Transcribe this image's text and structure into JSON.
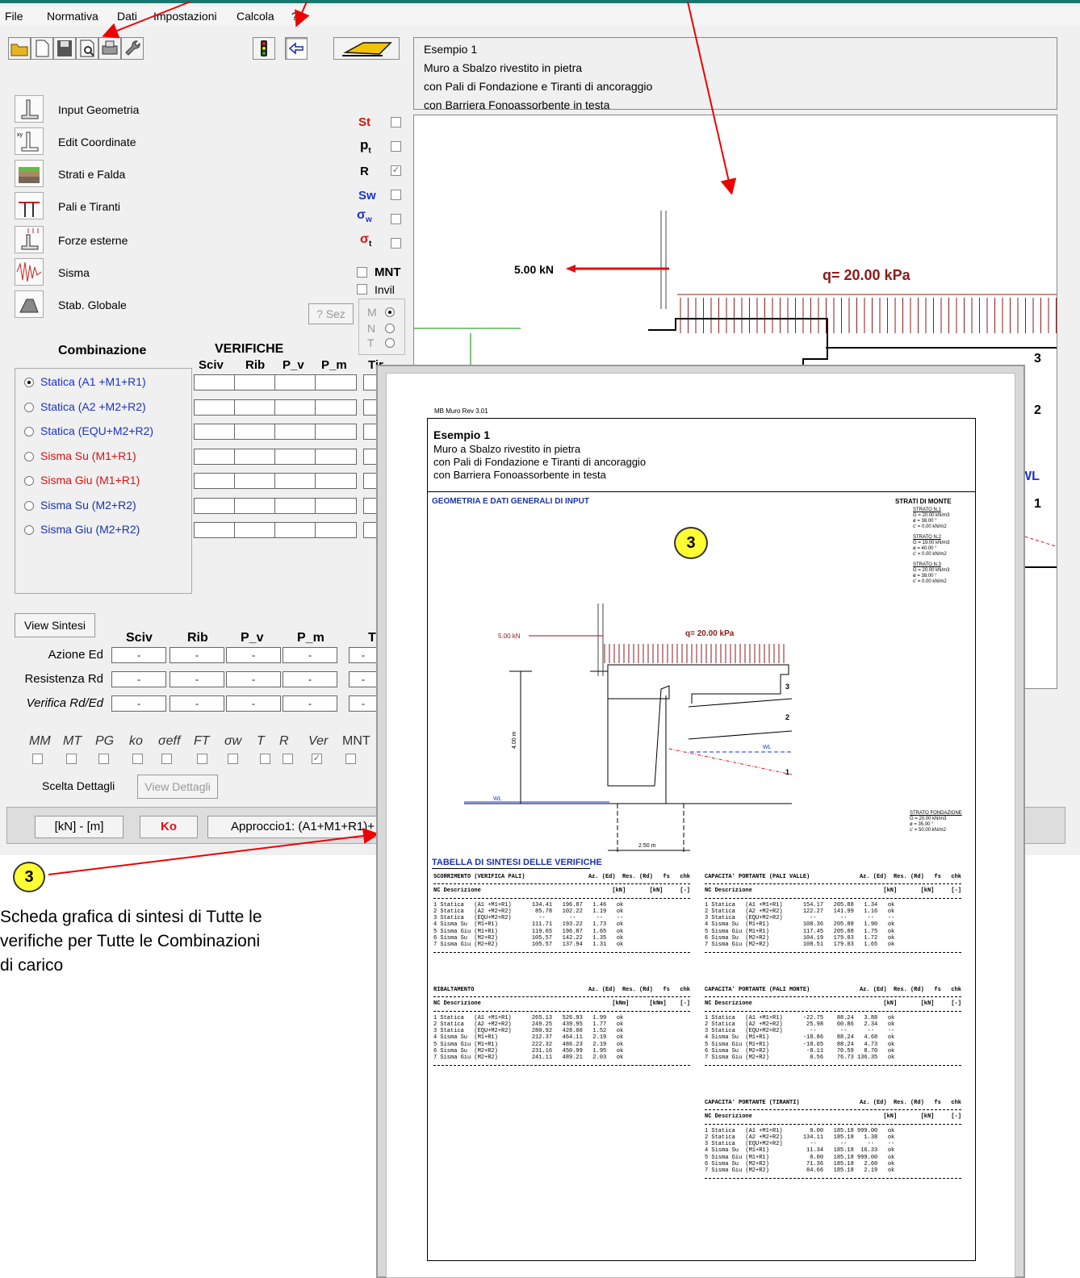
{
  "menu": [
    "File",
    "Normativa",
    "Dati",
    "Impostazioni",
    "Calcola",
    "?"
  ],
  "project": {
    "title": "Esempio 1",
    "line1": "Muro a Sbalzo rivestito in pietra",
    "line2": "con Pali di Fondazione e Tiranti di ancoraggio",
    "line3": "con Barriera Fonoassorbente in testa"
  },
  "sidebar": [
    {
      "label": "Input Geometria",
      "icon": "wall-geometry-icon"
    },
    {
      "label": "Edit Coordinate",
      "icon": "coordinates-icon"
    },
    {
      "label": "Strati e Falda",
      "icon": "layers-icon"
    },
    {
      "label": "Pali e Tiranti",
      "icon": "piles-icon"
    },
    {
      "label": "Forze esterne",
      "icon": "forces-icon"
    },
    {
      "label": "Sisma",
      "icon": "seismic-icon"
    },
    {
      "label": "Stab. Globale",
      "icon": "global-stability-icon"
    }
  ],
  "toggles": {
    "st": "St",
    "pt": "p",
    "pt_sub": "t",
    "r": "R",
    "sw": "Sw",
    "sw2": "σ",
    "sw2_sub": "w",
    "st2": "σ",
    "st2_sub": "t",
    "mnt": "MNT",
    "invil": "Invil",
    "sez": "? Sez",
    "m": "M",
    "n": "N",
    "t": "T"
  },
  "combinazioni": {
    "header": "Combinazione",
    "verifiche": "VERIFICHE",
    "cols": [
      "Sciv",
      "Rib",
      "P_v",
      "P_m",
      "Tir"
    ],
    "items": [
      {
        "label": "Statica  (A1 +M1+R1)",
        "color": "#1a33cc",
        "selected": true
      },
      {
        "label": "Statica  (A2 +M2+R2)",
        "color": "#1a33cc",
        "selected": false
      },
      {
        "label": "Statica  (EQU+M2+R2)",
        "color": "#1a33cc",
        "selected": false
      },
      {
        "label": "Sisma Su  (M1+R1)",
        "color": "#dd1111",
        "selected": false
      },
      {
        "label": "Sisma Giu (M1+R1)",
        "color": "#dd1111",
        "selected": false
      },
      {
        "label": "Sisma Su  (M2+R2)",
        "color": "#1a33aa",
        "selected": false
      },
      {
        "label": "Sisma Giu (M2+R2)",
        "color": "#1a33aa",
        "selected": false
      }
    ]
  },
  "sintesi": {
    "button": "View Sintesi",
    "cols": [
      "Sciv",
      "Rib",
      "P_v",
      "P_m",
      "T"
    ],
    "rows": [
      {
        "label": "Azione Ed",
        "values": [
          "-",
          "-",
          "-",
          "-",
          "-"
        ]
      },
      {
        "label": "Resistenza Rd",
        "values": [
          "-",
          "-",
          "-",
          "-",
          "-"
        ]
      },
      {
        "label": "Verifica Rd/Ed",
        "values": [
          "-",
          "-",
          "-",
          "-",
          "-"
        ]
      }
    ]
  },
  "flags": [
    "MM",
    "MT",
    "PG",
    "ko",
    "σeff",
    "FT",
    "σw",
    "T",
    "R",
    "Ver",
    "MNT"
  ],
  "dettagli": {
    "label": "Scelta Dettagli",
    "button": "View Dettagli"
  },
  "status": {
    "units": "[kN] - [m]",
    "result": "Ko",
    "approach": "Approccio1: (A1+M1+R1)+"
  },
  "drawing": {
    "force": "5.00 kN",
    "load": "q= 20.00 kPa",
    "layers": [
      "3",
      "2",
      "1"
    ],
    "wl": "WL"
  },
  "annotation": {
    "badge": "3",
    "text": "Scheda grafica di sintesi di Tutte le verifiche per Tutte le Combinazioni di carico"
  },
  "report": {
    "rev": "MB Muro Rev 3.01",
    "section_geo": "GEOMETRIA E DATI GENERALI DI INPUT",
    "strati_title": "STRATI DI MONTE",
    "strati": [
      {
        "name": "STRATO N.1",
        "g": "G = 20.00 kN/m3",
        "phi": "ø  = 38.00 °",
        "c": "c' = 0.00 kN/m2"
      },
      {
        "name": "STRATO N.2",
        "g": "G = 19.00 kN/m3",
        "phi": "ø  = 40.00 °",
        "c": "c' = 0.00 kN/m2"
      },
      {
        "name": "STRATO N.3",
        "g": "G = 20.00 kN/m3",
        "phi": "ø  = 38.00 °",
        "c": "c' = 0.00 kN/m2"
      }
    ],
    "fondazione": {
      "name": "STRATO FONDAZIONE",
      "g": "G = 20.00 kN/m3",
      "phi": "ø  = 35.00 °",
      "c": "c' = 50.00 kN/m2"
    },
    "force": "5.00 kN",
    "load": "q= 20.00 kPa",
    "height": "4.00 m",
    "width": "2.50 m",
    "wl": "WL",
    "layers": [
      "3",
      "2",
      "1"
    ],
    "tab_title": "TABELLA DI SINTESI DELLE VERIFICHE",
    "tables": [
      {
        "title": "SCORRIMENTO (VERIFICA PALI)",
        "units": "[kN]       [kN]     [-]",
        "rows": [
          "1 Statica   (A1 +M1+R1)      134.41   196.87   1.46   ok",
          "2 Statica   (A2 +M2+R2)       85.78   102.22   1.19   ok",
          "3 Statica   (EQU+M2+R2)        --       --      --    --",
          "4 Sisma Su  (M1+R1)          111.71   193.22   1.73   ok",
          "5 Sisma Giu (M1+R1)          119.65   196.87   1.65   ok",
          "6 Sisma Su  (M2+R2)          105.57   142.22   1.35   ok",
          "7 Sisma Giu (M2+R2)          105.57   137.94   1.31   ok"
        ]
      },
      {
        "title": "RIBALTAMENTO",
        "units": "[kNm]      [kNm]    [-]",
        "rows": [
          "1 Statica   (A1 +M1+R1)      265.13   526.93   1.99   ok",
          "2 Statica   (A2 +M2+R2)      249.25   439.95   1.77   ok",
          "3 Statica   (EQU+M2+R2)      280.92   428.00   1.52   ok",
          "4 Sisma Su  (M1+R1)          212.37   464.11   2.19   ok",
          "5 Sisma Giu (M1+R1)          222.32   486.23   2.19   ok",
          "6 Sisma Su  (M2+R2)          231.16   450.99   1.95   ok",
          "7 Sisma Giu (M2+R2)          241.11   489.21   2.03   ok"
        ]
      },
      {
        "title": "CAPACITA' PORTANTE (PALI VALLE)",
        "units": "[kN]       [kN]     [-]",
        "rows": [
          "1 Statica   (A1 +M1+R1)      154.17   205.88   1.34   ok",
          "2 Statica   (A2 +M2+R2)      122.27   141.99   1.16   ok",
          "3 Statica   (EQU+M2+R2)        --       --      --    --",
          "4 Sisma Su  (M1+R1)          108.36   205.88   1.90   ok",
          "5 Sisma Giu (M1+R1)          117.45   205.88   1.75   ok",
          "6 Sisma Su  (M2+R2)          104.19   179.03   1.72   ok",
          "7 Sisma Giu (M2+R2)          108.51   179.03   1.65   ok"
        ]
      },
      {
        "title": "CAPACITA' PORTANTE (PALI MONTE)",
        "units": "[kN]       [kN]     [-]",
        "rows": [
          "1 Statica   (A1 +M1+R1)      -22.75    88.24   3.88   ok",
          "2 Statica   (A2 +M2+R2)       25.98    60.86   2.34   ok",
          "3 Statica   (EQU+M2+R2)        --       --      --    --",
          "4 Sisma Su  (M1+R1)          -18.86    88.24   4.68   ok",
          "5 Sisma Giu (M1+R1)          -18.65    88.24   4.73   ok",
          "6 Sisma Su  (M2+R2)           -8.11    70.59   8.70   ok",
          "7 Sisma Giu (M2+R2)            0.56    76.73 136.35   ok"
        ]
      },
      {
        "title": "CAPACITA' PORTANTE (TIRANTI)",
        "units": "[kN]       [kN]     [-]",
        "rows": [
          "1 Statica   (A1 +M1+R1)        0.00   185.18 999.00   ok",
          "2 Statica   (A2 +M2+R2)      134.11   185.18   1.38   ok",
          "3 Statica   (EQU+M2+R2)        --       --      --    --",
          "4 Sisma Su  (M1+R1)           11.34   185.18  16.33   ok",
          "5 Sisma Giu (M1+R1)            0.00   185.18 999.00   ok",
          "6 Sisma Su  (M2+R2)           71.36   185.18   2.60   ok",
          "7 Sisma Giu (M2+R2)           84.66   185.18   2.19   ok"
        ]
      }
    ],
    "col_hdr": "Az. (Ed)  Res. (Rd)   fs   chk",
    "nc_hdr": "NC Descrizione"
  }
}
